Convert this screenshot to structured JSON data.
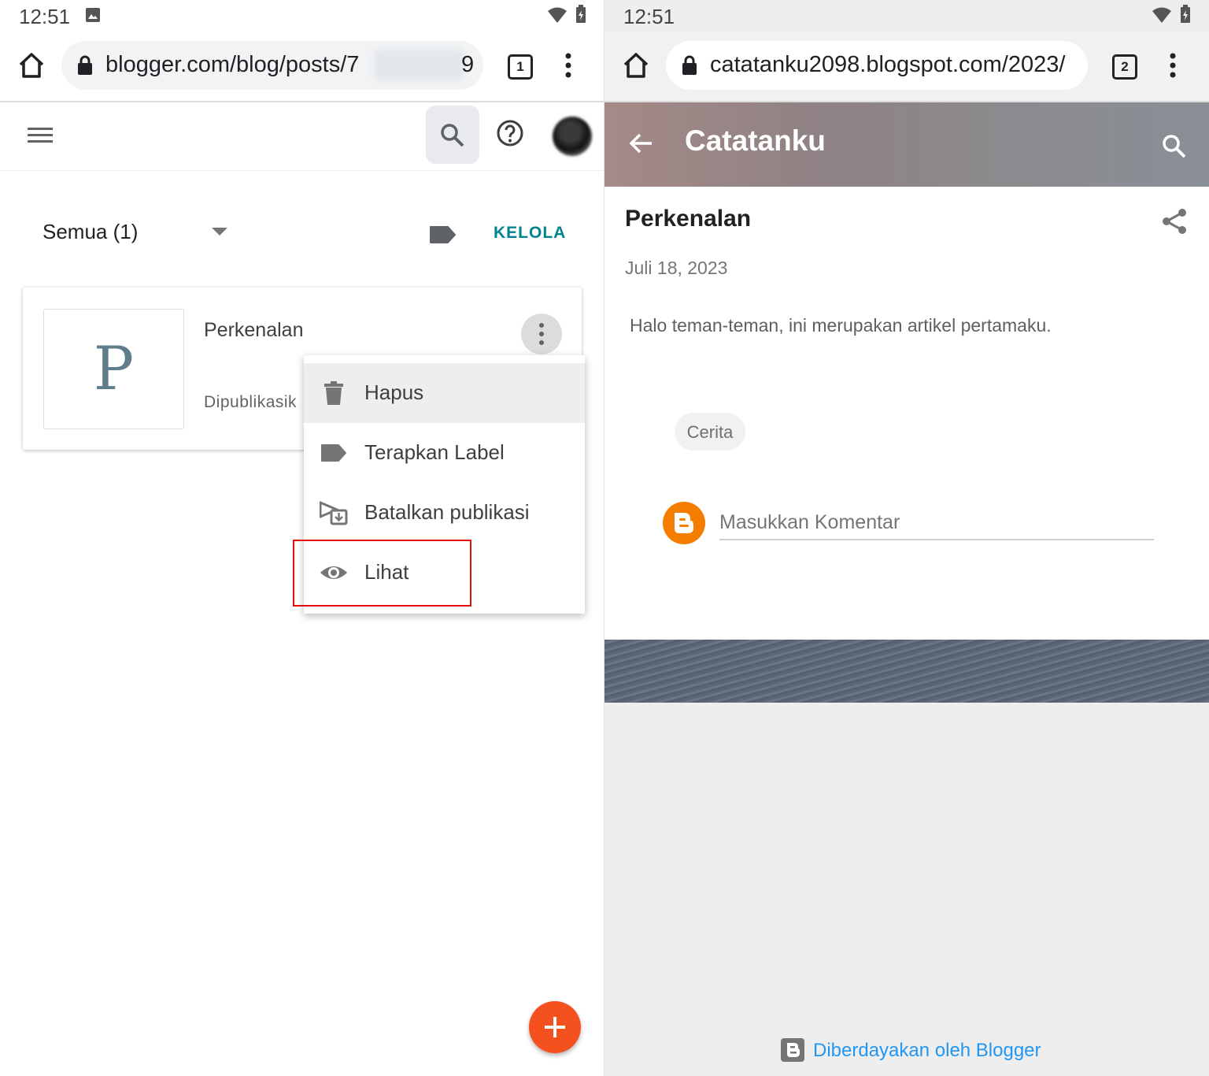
{
  "left": {
    "status": {
      "time": "12:51"
    },
    "browser": {
      "url_visible": "blogger.com/blog/posts/7",
      "url_suffix": "9",
      "tab_count": "1"
    },
    "filter": {
      "label": "Semua (1)",
      "manage": "KELOLA"
    },
    "post": {
      "thumb_letter": "P",
      "title": "Perkenalan",
      "status": "Dipublikasik"
    },
    "menu": {
      "items": [
        {
          "label": "Hapus",
          "icon": "trash-icon"
        },
        {
          "label": "Terapkan Label",
          "icon": "label-icon"
        },
        {
          "label": "Batalkan publikasi",
          "icon": "unpublish-icon"
        },
        {
          "label": "Lihat",
          "icon": "eye-icon"
        }
      ]
    }
  },
  "right": {
    "status": {
      "time": "12:51"
    },
    "browser": {
      "url": "catatanku2098.blogspot.com/2023/",
      "tab_count": "2"
    },
    "blog": {
      "title": "Catatanku",
      "post_title": "Perkenalan",
      "date": "Juli 18, 2023",
      "body": "Halo teman-teman, ini merupakan artikel pertamaku.",
      "tag": "Cerita",
      "comment_placeholder": "Masukkan Komentar",
      "footer": "Diberdayakan oleh Blogger"
    }
  },
  "colors": {
    "accent_teal": "#00838f",
    "fab": "#f4511e",
    "highlight_box": "#e10d0d",
    "blogger_orange": "#f57d00",
    "link_blue": "#2196f3"
  }
}
